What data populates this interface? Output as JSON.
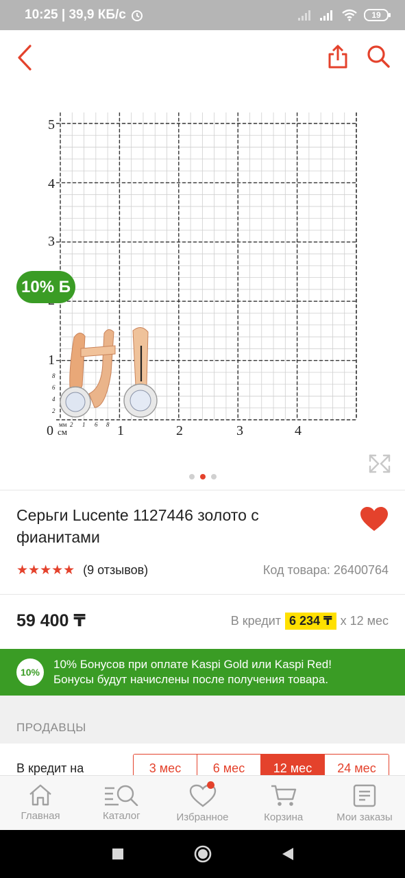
{
  "status_bar": {
    "time_speed": "10:25 | 39,9 КБ/с",
    "battery": "19"
  },
  "top_bar": {
    "back_icon": "back-arrow-icon",
    "share_icon": "share-icon",
    "search_icon": "search-icon"
  },
  "gallery": {
    "bonus_badge": "10% Б",
    "ruler_cm": [
      "0",
      "1",
      "2",
      "3",
      "4"
    ],
    "ruler_cm_unit": "см",
    "ruler_mm_unit": "мм",
    "ruler_mm_x": [
      "2",
      "1",
      "6",
      "8"
    ],
    "ruler_v": [
      "1",
      "2",
      "3",
      "4",
      "5"
    ],
    "ruler_mm_v": [
      "8",
      "6",
      "4",
      "2"
    ],
    "dots": 3,
    "active_dot": 1
  },
  "product": {
    "title": "Серьги Lucente 1127446 золото с фианитами",
    "stars": "★★★★★",
    "reviews": "(9 отзывов)",
    "code": "Код товара: 26400764",
    "price": "59 400 ₸",
    "credit_prefix": "В кредит",
    "credit_amount": "6 234 ₸",
    "credit_suffix": "x 12 мес"
  },
  "bonus_banner": {
    "circle": "10%",
    "line1": "10% Бонусов при оплате Kaspi Gold или Kaspi Red!",
    "line2": "Бонусы будут начислены после получения товара."
  },
  "sellers": {
    "title": "ПРОДАВЦЫ",
    "credit_label": "В кредит на",
    "terms": [
      "3 мес",
      "6 мес",
      "12 мес",
      "24 мес"
    ],
    "active_term": "12 мес"
  },
  "tab_bar": {
    "tabs": [
      "Главная",
      "Каталог",
      "Избранное",
      "Корзина",
      "Мои заказы"
    ]
  },
  "colors": {
    "accent": "#e4422c",
    "green": "#3a9c25",
    "credit_highlight": "#ffe000"
  }
}
